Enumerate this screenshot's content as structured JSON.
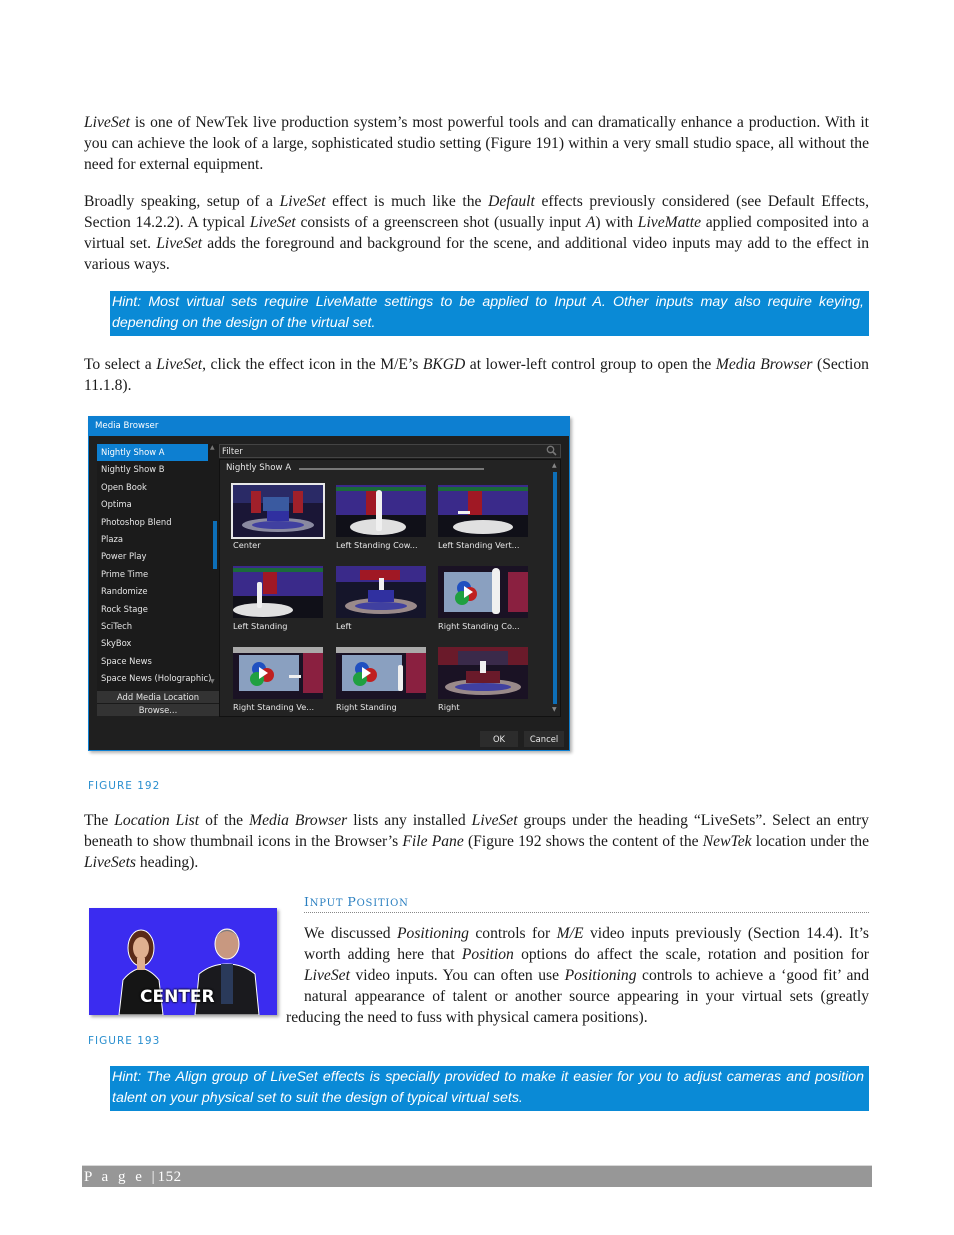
{
  "paragraphs": {
    "p1": {
      "i1": "LiveSet",
      "t1": " is one of NewTek live production system’s most powerful tools and can dramatically enhance a production.  With it you can achieve the look of a large, sophisticated studio setting (Figure 191) within a very small studio space, all without the need for external equipment."
    },
    "p2": {
      "t1": "Broadly speaking, setup of a ",
      "i1": "LiveSet",
      "t2": " effect is much like the ",
      "i2": "Default",
      "t3": " effects previously considered (see Default Effects, Section 14.2.2).  A typical ",
      "i3": "LiveSet",
      "t4": " consists of a greenscreen shot (usually input ",
      "i4": "A",
      "t5": ") with ",
      "i5": "LiveMatte",
      "t6": " applied composited into a virtual set. ",
      "i6": "LiveSet",
      "t7": " adds the foreground and background for the scene, and additional video inputs may add to the effect in various ways."
    },
    "p3": {
      "t1": "To select a ",
      "i1": "LiveSet",
      "t2": ", click the effect icon in the M/E’s ",
      "i2": "BKGD",
      "t3": " at lower-left control group to open the ",
      "i3": "Media Browser",
      "t4": " (Section 11.1.8)."
    },
    "p4": {
      "t1": "The ",
      "i1": "Location List",
      "t2": " of the ",
      "i2": "Media Browser",
      "t3": " lists any installed ",
      "i3": "LiveSet",
      "t4": " groups under the heading “LiveSets”. Select an entry beneath to show thumbnail icons in the Browser’s ",
      "i4": "File Pane",
      "t5": " (Figure 192 shows the content of the ",
      "i5": "NewTek",
      "t6": " location under the ",
      "i6": "LiveSets",
      "t7": " heading)."
    },
    "p5": {
      "t1": "We discussed ",
      "i1": "Positioning",
      "t2": " controls for ",
      "i2": "M/E",
      "t3": " video inputs previously (Section 14.4).  It’s worth adding here that ",
      "i3": "Position",
      "t4": " options do affect the scale, rotation and position for ",
      "i4": "LiveSet",
      "t5": " video inputs.  You can often use ",
      "i5": "Positioning",
      "t6": " controls to achieve a ‘good fit’ and natural appearance of talent or another source appearing in your virtual sets (greatly reducing the need to fuss with physical camera positions)."
    }
  },
  "hints": {
    "hint1": "Hint: Most virtual sets require LiveMatte settings to be applied to Input A.  Other inputs may also require keying, depending on the design of the virtual set.",
    "hint2": "Hint: The Align group of LiveSet effects is specially provided to make it easier for you to adjust cameras and position talent on your physical set to suit the design of typical virtual sets."
  },
  "figures": {
    "fig192_caption": "FIGURE 192",
    "fig193_caption": "FIGURE 193",
    "fig193_overlay": "CENTER"
  },
  "section": {
    "heading_first": "I",
    "heading_rest1": "NPUT ",
    "heading_second": "P",
    "heading_rest2": "OSITION"
  },
  "media_browser": {
    "title": "Media Browser",
    "filter_placeholder": "Filter",
    "search_icon": "search-icon",
    "locations": [
      "Nightly Show A",
      "Nightly Show B",
      "Open Book",
      "Optima",
      "Photoshop Blend",
      "Plaza",
      "Power Play",
      "Prime Time",
      "Randomize",
      "Rock Stage",
      "SciTech",
      "SkyBox",
      "Space News",
      "Space News (Holographic)"
    ],
    "selected_location": "Nightly Show A",
    "add_location_label": "Add Media Location",
    "browse_label": "Browse...",
    "pane_heading": "Nightly Show A",
    "thumbnails": [
      "Center",
      "Left Standing Cow...",
      "Left Standing Vert...",
      "Left Standing",
      "Left",
      "Right Standing Co...",
      "Right Standing Ve...",
      "Right Standing",
      "Right"
    ],
    "selected_thumbnail": "Center",
    "ok_label": "OK",
    "cancel_label": "Cancel"
  },
  "footer": {
    "page_label": "P a g e",
    "separator": "|",
    "page_number": "152"
  },
  "colors": {
    "accent_blue": "#0a8ad6",
    "dialog_blue": "#0d7fd1",
    "caption_blue": "#2a8fcf",
    "footer_gray": "#979797"
  }
}
